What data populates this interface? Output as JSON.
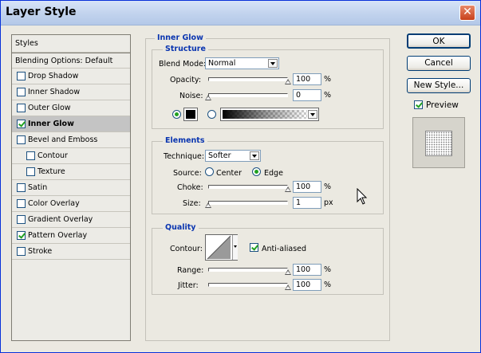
{
  "window": {
    "title": "Layer Style",
    "close_glyph": "✕"
  },
  "styles_panel": {
    "header": "Styles",
    "blending": "Blending Options: Default",
    "items": [
      {
        "label": "Drop Shadow",
        "checked": false
      },
      {
        "label": "Inner Shadow",
        "checked": false
      },
      {
        "label": "Outer Glow",
        "checked": false
      },
      {
        "label": "Inner Glow",
        "checked": true,
        "selected": true
      },
      {
        "label": "Bevel and Emboss",
        "checked": false
      },
      {
        "label": "Contour",
        "checked": false
      },
      {
        "label": "Texture",
        "checked": false
      },
      {
        "label": "Satin",
        "checked": false
      },
      {
        "label": "Color Overlay",
        "checked": false
      },
      {
        "label": "Gradient Overlay",
        "checked": false
      },
      {
        "label": "Pattern Overlay",
        "checked": true
      },
      {
        "label": "Stroke",
        "checked": false
      }
    ]
  },
  "inner_glow": {
    "title": "Inner Glow",
    "structure": {
      "title": "Structure",
      "blend_mode_label": "Blend Mode:",
      "blend_mode": "Normal",
      "opacity_label": "Opacity:",
      "opacity": "100",
      "opacity_unit": "%",
      "noise_label": "Noise:",
      "noise": "0",
      "noise_unit": "%",
      "color_mode": "solid",
      "color": "#000000"
    },
    "elements": {
      "title": "Elements",
      "technique_label": "Technique:",
      "technique": "Softer",
      "source_label": "Source:",
      "source_center": "Center",
      "source_edge": "Edge",
      "source_selected": "Edge",
      "choke_label": "Choke:",
      "choke": "100",
      "choke_unit": "%",
      "size_label": "Size:",
      "size": "1",
      "size_unit": "px"
    },
    "quality": {
      "title": "Quality",
      "contour_label": "Contour:",
      "anti_aliased_label": "Anti-aliased",
      "anti_aliased": true,
      "range_label": "Range:",
      "range": "100",
      "range_unit": "%",
      "jitter_label": "Jitter:",
      "jitter": "100",
      "jitter_unit": "%"
    }
  },
  "buttons": {
    "ok": "OK",
    "cancel": "Cancel",
    "new_style": "New Style..."
  },
  "preview": {
    "label": "Preview",
    "checked": true
  },
  "colors": {
    "accent_title": "#0a35b0",
    "selected_row": "#c4c4c4",
    "check_green": "#21a121"
  }
}
